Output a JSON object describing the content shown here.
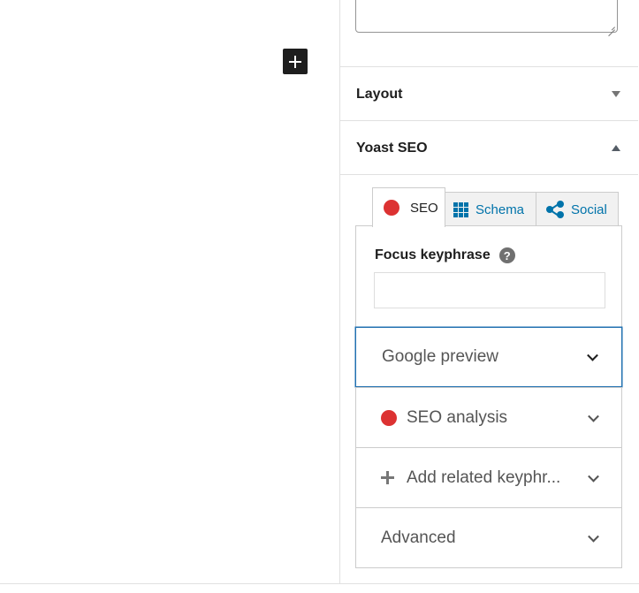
{
  "sidebar": {
    "panels": [
      {
        "title": "Layout",
        "state": "collapsed"
      },
      {
        "title": "Yoast SEO",
        "state": "expanded"
      }
    ]
  },
  "yoast": {
    "tabs": [
      {
        "label": "SEO",
        "icon": "red-dot-icon",
        "active": true
      },
      {
        "label": "Schema",
        "icon": "grid-icon",
        "active": false
      },
      {
        "label": "Social",
        "icon": "share-icon",
        "active": false
      }
    ],
    "focus_keyphrase": {
      "label": "Focus keyphrase",
      "help": "?",
      "value": ""
    },
    "sections": [
      {
        "label": "Google preview",
        "focused": true
      },
      {
        "label": "SEO analysis",
        "icon": "red-dot-icon"
      },
      {
        "label": "Add related keyphr...",
        "icon": "plus-icon"
      },
      {
        "label": "Advanced"
      }
    ]
  },
  "colors": {
    "accent": "#0073aa",
    "status_bad": "#dc3232",
    "focus_outline": "#2271b1",
    "inserter_bg": "#1e1e1e"
  }
}
